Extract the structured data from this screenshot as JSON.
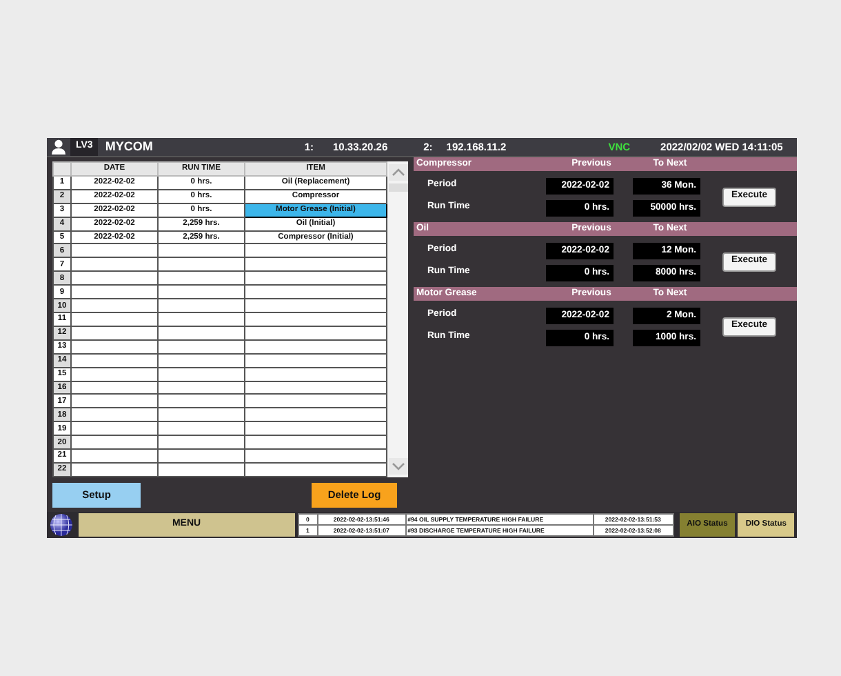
{
  "header": {
    "level": "LV3",
    "title": "MYCOM",
    "ip1_label": "1:",
    "ip1": "10.33.20.26",
    "ip2_label": "2:",
    "ip2": "192.168.11.2",
    "vnc": "VNC",
    "datetime": "2022/02/02 WED 14:11:05"
  },
  "log_table": {
    "columns": [
      "DATE",
      "RUN TIME",
      "ITEM"
    ],
    "rows": [
      {
        "number": "1",
        "date": "2022-02-02",
        "run_time": "0 hrs.",
        "item": "Oil (Replacement)",
        "selected": false
      },
      {
        "number": "2",
        "date": "2022-02-02",
        "run_time": "0 hrs.",
        "item": "Compressor",
        "selected": false
      },
      {
        "number": "3",
        "date": "2022-02-02",
        "run_time": "0 hrs.",
        "item": "Motor Grease (Initial)",
        "selected": true
      },
      {
        "number": "4",
        "date": "2022-02-02",
        "run_time": "2,259 hrs.",
        "item": "Oil (Initial)",
        "selected": false
      },
      {
        "number": "5",
        "date": "2022-02-02",
        "run_time": "2,259 hrs.",
        "item": "Compressor (Initial)",
        "selected": false
      },
      {
        "number": "6"
      },
      {
        "number": "7"
      },
      {
        "number": "8"
      },
      {
        "number": "9"
      },
      {
        "number": "10"
      },
      {
        "number": "11"
      },
      {
        "number": "12"
      },
      {
        "number": "13"
      },
      {
        "number": "14"
      },
      {
        "number": "15"
      },
      {
        "number": "16"
      },
      {
        "number": "17"
      },
      {
        "number": "18"
      },
      {
        "number": "19"
      },
      {
        "number": "20"
      },
      {
        "number": "21"
      },
      {
        "number": "22"
      }
    ]
  },
  "buttons": {
    "setup": "Setup",
    "delete_log": "Delete Log"
  },
  "maintenance": [
    {
      "title": "Compressor",
      "previous_label": "Previous",
      "next_label": "To Next",
      "rows": [
        {
          "label": "Period",
          "previous": "2022-02-02",
          "next": "36 Mon."
        },
        {
          "label": "Run Time",
          "previous": "0 hrs.",
          "next": "50000 hrs."
        }
      ],
      "button": "Execute"
    },
    {
      "title": "Oil",
      "previous_label": "Previous",
      "next_label": "To Next",
      "rows": [
        {
          "label": "Period",
          "previous": "2022-02-02",
          "next": "12 Mon."
        },
        {
          "label": "Run Time",
          "previous": "0 hrs.",
          "next": "8000 hrs."
        }
      ],
      "button": "Execute"
    },
    {
      "title": "Motor Grease",
      "previous_label": "Previous",
      "next_label": "To Next",
      "rows": [
        {
          "label": "Period",
          "previous": "2022-02-02",
          "next": "2 Mon."
        },
        {
          "label": "Run Time",
          "previous": "0 hrs.",
          "next": "1000 hrs."
        }
      ],
      "button": "Execute"
    }
  ],
  "bottom_bar": {
    "menu": "MENU",
    "alarms": [
      {
        "number": "0",
        "occurred": "2022-02-02-13:51:46",
        "message": "#94 OIL SUPPLY TEMPERATURE HIGH FAILURE",
        "cleared": "2022-02-02-13:51:53"
      },
      {
        "number": "1",
        "occurred": "2022-02-02-13:51:07",
        "message": "#93 DISCHARGE TEMPERATURE HIGH FAILURE",
        "cleared": "2022-02-02-13:52:08"
      }
    ],
    "status_buttons": [
      {
        "label": "AIO Status",
        "selected": true
      },
      {
        "label": "DIO Status",
        "selected": false
      }
    ]
  }
}
